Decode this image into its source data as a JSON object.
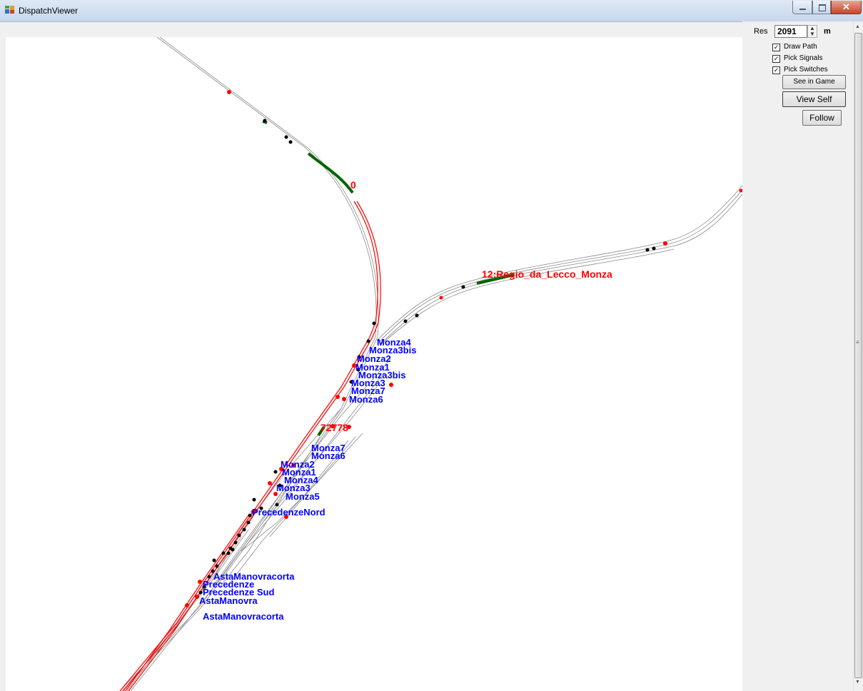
{
  "window": {
    "title": "DispatchViewer",
    "close_glyph": "✕"
  },
  "panel": {
    "res_label": "Res",
    "res_value": "2091",
    "res_unit": "m",
    "checkboxes": [
      {
        "label": "Draw Path",
        "checked": true
      },
      {
        "label": "Pick Signals",
        "checked": true
      },
      {
        "label": "Pick Switches",
        "checked": true
      }
    ],
    "buttons": {
      "see_in_game": "See in Game",
      "view_self": "View Self",
      "follow": "Follow"
    }
  },
  "map": {
    "train_labels": [
      "0",
      "12:Regio_da_Lecco_Monza",
      "72778"
    ],
    "station_labels": [
      "Monza4",
      "Monza3bis",
      "Monza2",
      "Monza1",
      "Monza3bis",
      "Monza3",
      "Monza7",
      "Monza6",
      "Monza7",
      "Monza6",
      "Monza2",
      "Monza1",
      "Monza4",
      "Monza3",
      "Monza5",
      "PrecedenzeNord",
      "AstaManovracorta",
      "Precedenze",
      "Precedenze Sud",
      "AstaManovra",
      "AstaManovracorta"
    ],
    "colors": {
      "path": "#ff0000",
      "occupied": "#006400",
      "label_blue": "#0000ff",
      "track": "#7f7f7f"
    }
  }
}
